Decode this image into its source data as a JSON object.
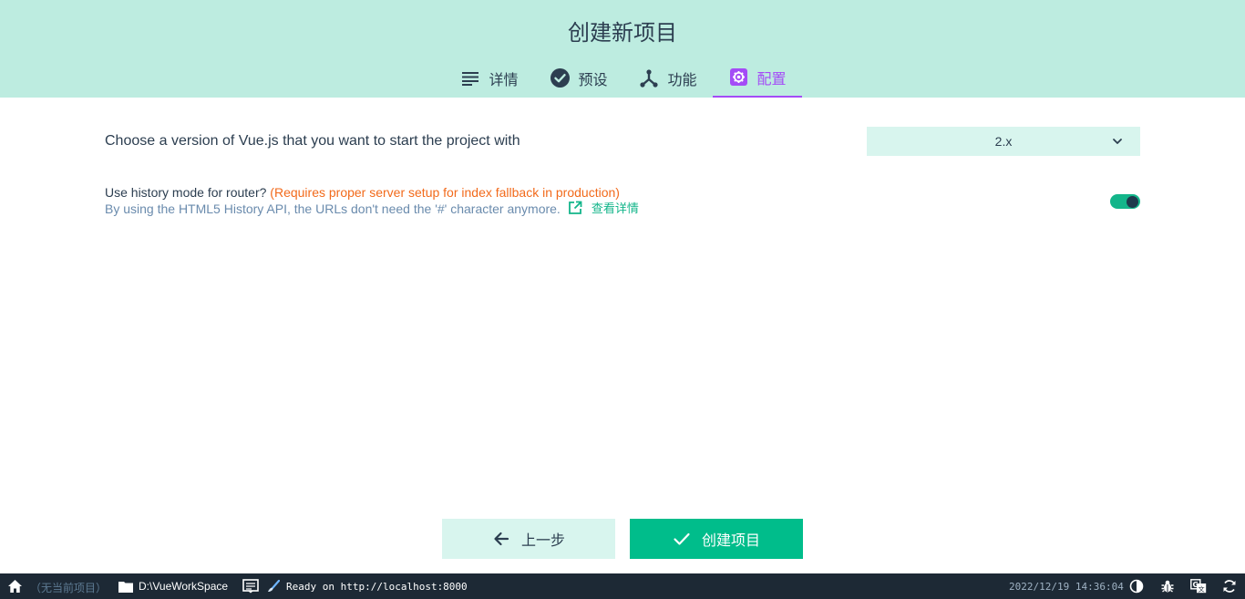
{
  "header": {
    "title": "创建新项目",
    "tabs": [
      {
        "label": "详情",
        "icon": "list-icon"
      },
      {
        "label": "预设",
        "icon": "check-circle-icon"
      },
      {
        "label": "功能",
        "icon": "fork-icon"
      },
      {
        "label": "配置",
        "icon": "settings-icon",
        "active": true
      }
    ]
  },
  "config": {
    "vue_version": {
      "label": "Choose a version of Vue.js that you want to start the project with",
      "selected": "2.x"
    },
    "history_mode": {
      "question": "Use history mode for router?",
      "warning": "(Requires proper server setup for index fallback in production)",
      "description": "By using the HTML5 History API, the URLs don't need the '#' character anymore.",
      "link_label": "查看详情",
      "enabled": true
    }
  },
  "actions": {
    "prev_label": "上一步",
    "create_label": "创建项目"
  },
  "statusbar": {
    "no_project": "（无当前项目）",
    "path": "D:\\VueWorkSpace",
    "log": "Ready on http://localhost:8000",
    "datetime": "2022/12/19 14:36:04"
  },
  "colors": {
    "header_bg": "#bdece0",
    "accent": "#a44cf6",
    "primary": "#00bd8b",
    "warning": "#f26a1b",
    "statusbar_bg": "#1d2935"
  }
}
